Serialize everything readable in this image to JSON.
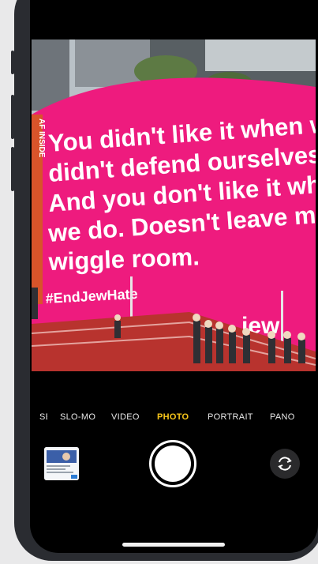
{
  "camera": {
    "modes": [
      {
        "label": "SE"
      },
      {
        "label": "SLO-MO"
      },
      {
        "label": "VIDEO"
      },
      {
        "label": "PHOTO"
      },
      {
        "label": "PORTRAIT"
      },
      {
        "label": "PANO"
      }
    ],
    "active_mode": "PHOTO",
    "accent_color": "#f7c61b"
  },
  "viewfinder": {
    "billboard_lines": [
      "You didn't like it when we",
      "didn't defend ourselves.",
      "And you don't like it when",
      "we do. Doesn't leave much",
      "wiggle room."
    ],
    "hashtag": "#EndJewHate",
    "brand_fragment": "jew",
    "side_sign": "AF INSIDE",
    "billboard_color": "#ee1b7e"
  },
  "icons": {
    "shutter": "shutter-button",
    "flip": "camera-flip-icon",
    "thumbnail": "last-photo-thumbnail"
  }
}
